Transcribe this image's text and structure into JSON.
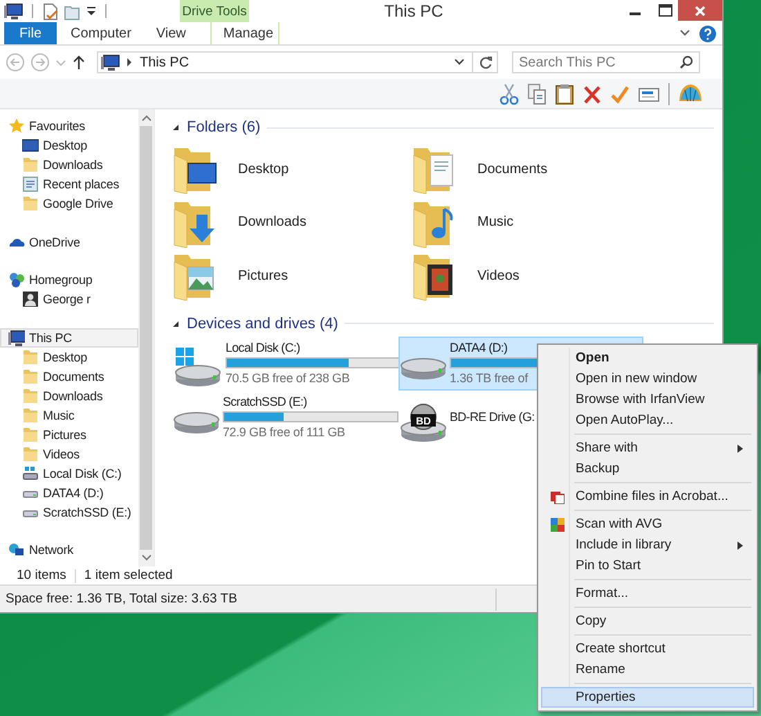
{
  "window": {
    "title": "This PC",
    "context_tab_group": "Drive Tools"
  },
  "ribbon_tabs": [
    {
      "label": "File",
      "kind": "file"
    },
    {
      "label": "Computer",
      "kind": "plain"
    },
    {
      "label": "View",
      "kind": "plain"
    },
    {
      "label": "Manage",
      "kind": "contextual"
    }
  ],
  "address": {
    "path": "This PC",
    "search_placeholder": "Search This PC"
  },
  "nav_tree": [
    {
      "label": "Favourites",
      "kind": "favourites",
      "selected": false,
      "children": [
        {
          "label": "Desktop",
          "kind": "desktop",
          "selected": false
        },
        {
          "label": "Downloads",
          "kind": "folder",
          "selected": false
        },
        {
          "label": "Recent places",
          "kind": "recent",
          "selected": false
        },
        {
          "label": "Google Drive",
          "kind": "folder",
          "selected": false
        }
      ]
    },
    {
      "label": "OneDrive",
      "kind": "cloud",
      "selected": false
    },
    {
      "label": "Homegroup",
      "kind": "homegroup",
      "selected": false,
      "children": [
        {
          "label": "George r",
          "kind": "user",
          "selected": false
        }
      ]
    },
    {
      "label": "This PC",
      "kind": "pc",
      "selected": true,
      "children": [
        {
          "label": "Desktop",
          "kind": "folder",
          "selected": false
        },
        {
          "label": "Documents",
          "kind": "folder",
          "selected": false
        },
        {
          "label": "Downloads",
          "kind": "folder",
          "selected": false
        },
        {
          "label": "Music",
          "kind": "folder",
          "selected": false
        },
        {
          "label": "Pictures",
          "kind": "folder",
          "selected": false
        },
        {
          "label": "Videos",
          "kind": "folder",
          "selected": false
        },
        {
          "label": "Local Disk (C:)",
          "kind": "system-drive",
          "selected": false
        },
        {
          "label": "DATA4 (D:)",
          "kind": "drive",
          "selected": false
        },
        {
          "label": "ScratchSSD (E:)",
          "kind": "drive",
          "selected": false
        }
      ]
    },
    {
      "label": "Network",
      "kind": "network",
      "selected": false
    }
  ],
  "folders": {
    "heading": "Folders (6)",
    "items": [
      {
        "name": "Desktop",
        "kind": "desktop"
      },
      {
        "name": "Documents",
        "kind": "documents"
      },
      {
        "name": "Downloads",
        "kind": "downloads"
      },
      {
        "name": "Music",
        "kind": "music"
      },
      {
        "name": "Pictures",
        "kind": "pictures"
      },
      {
        "name": "Videos",
        "kind": "videos"
      }
    ]
  },
  "drives": {
    "heading": "Devices and drives (4)",
    "items": [
      {
        "name": "Local Disk (C:)",
        "kind": "system",
        "level": 0.7,
        "free": "70.5 GB free of 238 GB",
        "selected": false
      },
      {
        "name": "DATA4 (D:)",
        "kind": "disk",
        "level": 0.63,
        "free": "1.36 TB free of",
        "selected": true
      },
      {
        "name": "ScratchSSD (E:)",
        "kind": "disk",
        "level": 0.34,
        "free": "72.9 GB free of 111 GB",
        "selected": false
      },
      {
        "name": "BD-RE Drive (G:",
        "kind": "optical",
        "badge": "BD",
        "selected": false
      }
    ]
  },
  "status": {
    "item_count": "10 items",
    "selection": "1 item selected",
    "space": "Space free: 1.36 TB, Total size: 3.63 TB"
  },
  "context_menu": {
    "groups": [
      [
        {
          "label": "Open",
          "kind": "default",
          "selected": false
        },
        {
          "label": "Open in new window",
          "kind": "plain",
          "selected": false
        },
        {
          "label": "Browse with IrfanView",
          "kind": "plain",
          "selected": false
        },
        {
          "label": "Open AutoPlay...",
          "kind": "plain",
          "selected": false
        }
      ],
      [
        {
          "label": "Share with",
          "kind": "submenu",
          "selected": false
        },
        {
          "label": "Backup",
          "kind": "plain",
          "selected": false
        }
      ],
      [
        {
          "label": "Combine files in Acrobat...",
          "kind": "with-icon",
          "selected": false
        }
      ],
      [
        {
          "label": "Scan with AVG",
          "kind": "with-icon",
          "selected": false
        },
        {
          "label": "Include in library",
          "kind": "submenu",
          "selected": false
        },
        {
          "label": "Pin to Start",
          "kind": "plain",
          "selected": false
        }
      ],
      [
        {
          "label": "Format...",
          "kind": "plain",
          "selected": false
        }
      ],
      [
        {
          "label": "Copy",
          "kind": "plain",
          "selected": false
        }
      ],
      [
        {
          "label": "Create shortcut",
          "kind": "plain",
          "selected": false
        },
        {
          "label": "Rename",
          "kind": "plain",
          "selected": false
        }
      ],
      [
        {
          "label": "Properties",
          "kind": "plain",
          "selected": true
        }
      ]
    ]
  }
}
